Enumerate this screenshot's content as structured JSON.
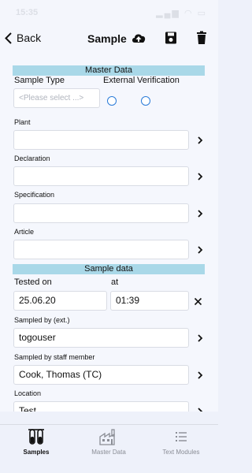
{
  "status_bar": {
    "time": "15:35",
    "indicators": "▂▄▆ ◠ ▭"
  },
  "navbar": {
    "back_label": "Back",
    "title": "Sample",
    "icons": [
      "chevron-left-icon",
      "cloud-upload-icon",
      "save-icon",
      "trash-icon"
    ]
  },
  "master_data": {
    "header": "Master Data",
    "sample_type_label": "Sample Type",
    "sample_type_placeholder": "<Please select ...>",
    "external_label": "External",
    "verification_label": "Verification",
    "plant_label": "Plant",
    "plant_value": "",
    "declaration_label": "Declaration",
    "declaration_value": "",
    "specification_label": "Specification",
    "specification_value": "",
    "article_label": "Article",
    "article_value": ""
  },
  "sample_data": {
    "header": "Sample data",
    "tested_on_label": "Tested on",
    "at_label": "at",
    "date_value": "25.06.20",
    "time_value": "01:39",
    "sampled_by_ext_label": "Sampled by (ext.)",
    "sampled_by_ext_value": "togouser",
    "sampled_by_staff_label": "Sampled by staff member",
    "sampled_by_staff_value": "Cook, Thomas (TC)",
    "location_label": "Location",
    "location_value": "Test..."
  },
  "tabbar": {
    "tabs": [
      {
        "label": "Samples",
        "active": true
      },
      {
        "label": "Master Data",
        "active": false
      },
      {
        "label": "Text Modules",
        "active": false
      }
    ]
  },
  "colors": {
    "accent": "#2a7bd8",
    "section_header": "#a9d8e8",
    "background": "#f5f7fd"
  }
}
